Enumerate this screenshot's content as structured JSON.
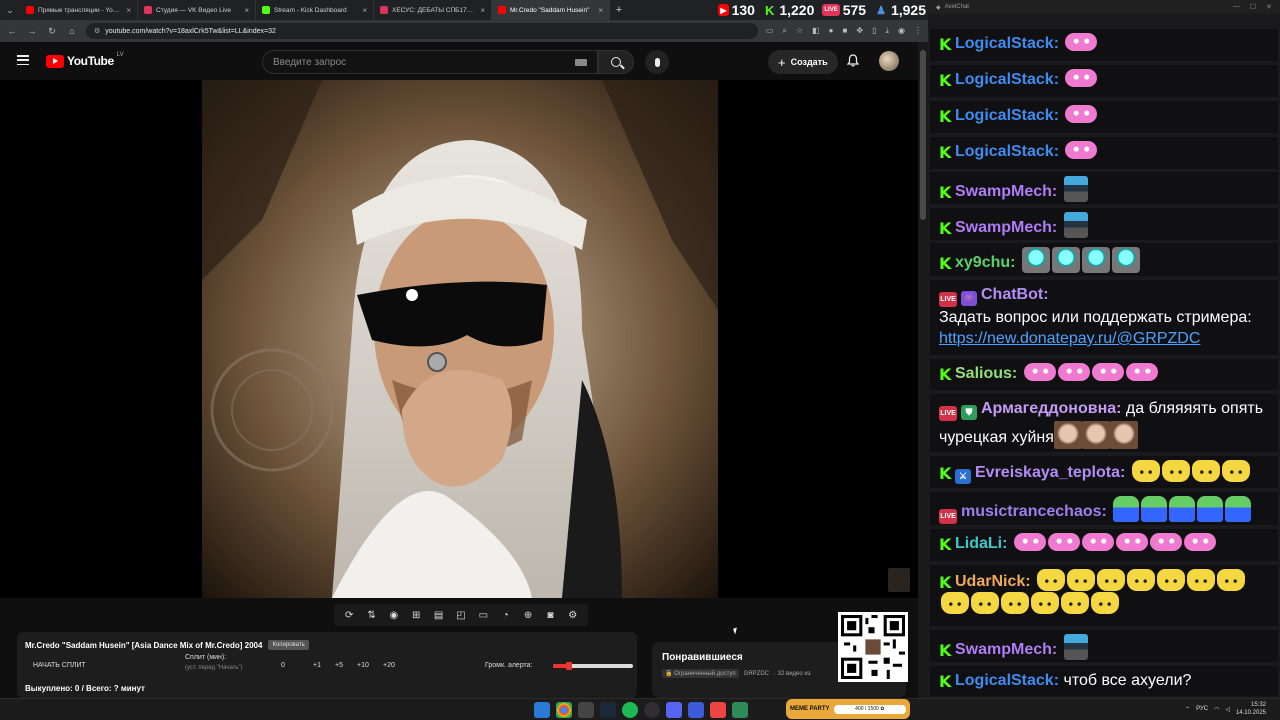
{
  "browser": {
    "tabs": [
      {
        "title": "Прямые трансляции - YouTub",
        "color": "#ff0000",
        "active": false
      },
      {
        "title": "Студия — VK Видео Live",
        "color": "#e2345a",
        "active": false
      },
      {
        "title": "Stream - Kick Dashboard",
        "color": "#53fc18",
        "active": false
      },
      {
        "title": "ХЕСУС: ДЕБАТЫ СПБ1703 И Мос",
        "color": "#e2345a",
        "active": false
      },
      {
        "title": "Mr.Credo \"Saddam Husein\"",
        "color": "#ff0000",
        "active": true
      }
    ],
    "url": "youtube.com/watch?v=18axlCrk5Tw&list=LL&index=32"
  },
  "stream_stats": [
    {
      "platform": "youtube",
      "value": "130",
      "color": "#ff0000",
      "glyph": "▶"
    },
    {
      "platform": "kick",
      "value": "1,220",
      "color": "#53fc18",
      "glyph": "K"
    },
    {
      "platform": "vk-live",
      "value": "575",
      "color": "#e2345a",
      "glyph": "LIVE"
    },
    {
      "platform": "total",
      "value": "1,925",
      "color": "#4a90e2",
      "glyph": "👤"
    }
  ],
  "youtube": {
    "logo_text": "YouTube",
    "country": "LV",
    "search_placeholder": "Введите запрос",
    "create_label": "Создать"
  },
  "controls": {
    "icons": [
      "loop-icon",
      "sort-icon",
      "audio-icon",
      "queue-icon",
      "playlist-icon",
      "pip-icon",
      "theater-icon",
      "speed-icon",
      "add-icon",
      "screenshot-icon",
      "settings-icon"
    ]
  },
  "info_panel": {
    "title": "Mr.Credo \"Saddam Husein\" [Asia Dance Mix of Mr.Credo] 2004",
    "badge": "Копировать",
    "start_split": "НАЧАТЬ СПЛИТ",
    "split_label": "Сплит (мин):",
    "split_hint": "(уст. перед \"Начать\")",
    "split_value": "0",
    "increments": [
      "+1",
      "+5",
      "+10",
      "+20"
    ],
    "alert_volume_label": "Громк. алерта:",
    "alert_volume_fraction": 0.2,
    "footer": "Выкуплено: 0 / Всего: ? минут"
  },
  "playlist": {
    "title": "Понравившиеся",
    "access": "Ограниченный доступ",
    "owner": "GRPZDC",
    "count": "· 32 видео из"
  },
  "chat": {
    "window_title": "AxelChat",
    "messages": [
      {
        "badges": [
          "k"
        ],
        "user": "LogicalStack:",
        "color": "#3f8cf0",
        "emotes": [
          "em-pink"
        ]
      },
      {
        "badges": [
          "k"
        ],
        "user": "LogicalStack:",
        "color": "#3f8cf0",
        "emotes": [
          "em-pink"
        ]
      },
      {
        "badges": [
          "k"
        ],
        "user": "LogicalStack:",
        "color": "#3f8cf0",
        "emotes": [
          "em-pink"
        ]
      },
      {
        "badges": [
          "k"
        ],
        "user": "LogicalStack:",
        "color": "#3f8cf0",
        "emotes": [
          "em-pink"
        ]
      },
      {
        "badges": [
          "k"
        ],
        "user": "SwampMech:",
        "color": "#b07cf7",
        "emotes": [
          "em-mech"
        ]
      },
      {
        "badges": [
          "k"
        ],
        "user": "SwampMech:",
        "color": "#b07cf7",
        "emotes": [
          "em-mech"
        ]
      },
      {
        "badges": [
          "k"
        ],
        "user": "xy9chu:",
        "color": "#5bd16a",
        "emotes": [
          "em-teal",
          "em-teal",
          "em-teal",
          "em-teal"
        ]
      },
      {
        "badges": [
          "live",
          "robot"
        ],
        "user": "ChatBot:",
        "color": "#b48cf7",
        "text": "Задать вопрос или поддержать стримера:",
        "link": "https://new.donatepay.ru/@GRPZDC",
        "block": true
      },
      {
        "badges": [
          "k"
        ],
        "user": "Salious:",
        "color": "#93e07a",
        "emotes": [
          "em-pink",
          "em-pink",
          "em-pink",
          "em-pink"
        ]
      },
      {
        "badges": [
          "live",
          "shield"
        ],
        "user": "Армагеддоновна:",
        "color": "#c49cf5",
        "text": "да бляяяять опять чурецкая хуйня",
        "emotes": [
          "em-face",
          "em-face",
          "em-face"
        ]
      },
      {
        "badges": [
          "k",
          "sword"
        ],
        "user": "Evreiskaya_teplota:",
        "color": "#b48cf7",
        "emotes": [
          "em-cat",
          "em-cat",
          "em-cat",
          "em-cat"
        ]
      },
      {
        "badges": [
          "live"
        ],
        "user": "musictrancechaos:",
        "color": "#a07ef0",
        "emotes": [
          "em-frog",
          "em-frog",
          "em-frog",
          "em-frog",
          "em-frog"
        ]
      },
      {
        "badges": [
          "k"
        ],
        "user": "LidaLi:",
        "color": "#3ec9c9",
        "emotes": [
          "em-pink",
          "em-pink",
          "em-pink",
          "em-pink",
          "em-pink",
          "em-pink"
        ]
      },
      {
        "badges": [
          "k"
        ],
        "user": "UdarNick:",
        "color": "#f0a95a",
        "emotes": [
          "em-cat",
          "em-cat",
          "em-cat",
          "em-cat",
          "em-cat",
          "em-cat",
          "em-cat",
          "em-cat",
          "em-cat",
          "em-cat",
          "em-cat",
          "em-cat",
          "em-cat"
        ]
      },
      {
        "badges": [
          "k"
        ],
        "user": "SwampMech:",
        "color": "#b07cf7",
        "emotes": [
          "em-mech"
        ]
      },
      {
        "badges": [
          "k"
        ],
        "user": "LogicalStack:",
        "color": "#3f8cf0",
        "text": "чтоб все ахуели?"
      }
    ]
  },
  "taskbar": {
    "widget_title": "MEME PARTY",
    "widget_progress": "400 / 1500 ✿",
    "lang": "РУС",
    "time": "15:32",
    "date": "14.10.2025"
  }
}
